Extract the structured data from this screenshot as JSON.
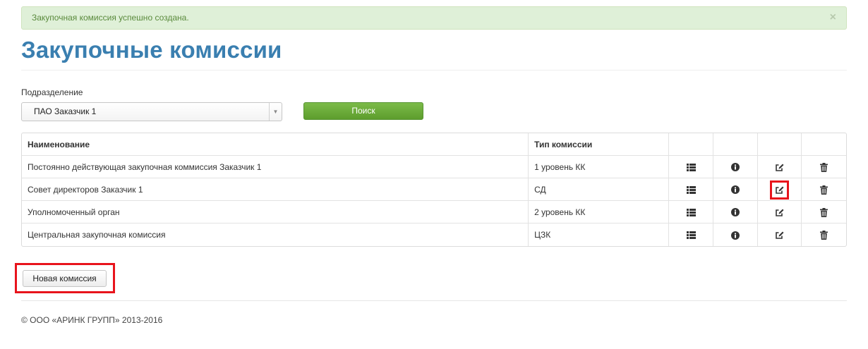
{
  "alert": {
    "message": "Закупочная комиссия успешно создана.",
    "close": "×"
  },
  "page": {
    "title": "Закупочные комиссии"
  },
  "filter": {
    "label": "Подразделение",
    "selected": "ПАО Заказчик 1",
    "arrow": "▼",
    "search_label": "Поиск"
  },
  "table": {
    "headers": [
      "Наименование",
      "Тип комиссии"
    ],
    "rows": [
      {
        "name": "Постоянно действующая закупочная коммиссия Заказчик 1",
        "type": "1 уровень КК"
      },
      {
        "name": "Совет директоров Заказчик 1",
        "type": "СД"
      },
      {
        "name": "Уполномоченный орган",
        "type": "2 уровень КК"
      },
      {
        "name": "Центральная закупочная комиссия",
        "type": "ЦЗК"
      }
    ],
    "row_icons": [
      "list-icon",
      "info-icon",
      "edit-icon",
      "trash-icon"
    ],
    "highlighted_edit_row": 1
  },
  "actions": {
    "new_label": "Новая комиссия"
  },
  "footer": {
    "copyright": "© ООО «АРИНК ГРУПП» 2013-2016"
  },
  "colors": {
    "title": "#3a7fb0",
    "alert_bg": "#dff0d8",
    "search_btn": "#6aab39",
    "highlight": "#e8141c"
  }
}
